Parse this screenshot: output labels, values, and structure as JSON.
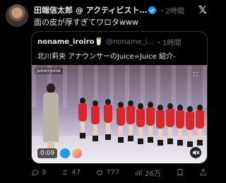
{
  "post": {
    "display_name": "田端信太郎 @ アクティビスト…",
    "time": "・2時間",
    "text": "面の皮が厚すぎてワロタwww"
  },
  "quote": {
    "display_name": "noname_iroiro🥛",
    "handle": "@noname_i...",
    "time": "・1時間",
    "text": "北川莉央 アナウンサーのJuice=Juice 紹介-",
    "video": {
      "elapsed": "0:09",
      "overlay_logo": "Juice=Juice"
    }
  },
  "actions": {
    "replies": "9",
    "reposts": "47",
    "likes": "777",
    "views": "26万"
  },
  "icons": {
    "x_logo": "x-logo-icon",
    "verified": "verified-badge-icon",
    "reply": "reply-icon",
    "repost": "repost-icon",
    "like": "heart-icon",
    "views": "views-icon",
    "bookmark": "bookmark-icon",
    "share": "share-icon"
  },
  "colors": {
    "background": "#000000",
    "text": "#e7e9ea",
    "muted": "#71767b",
    "accent": "#1d9bf0",
    "border": "#2f3336"
  }
}
